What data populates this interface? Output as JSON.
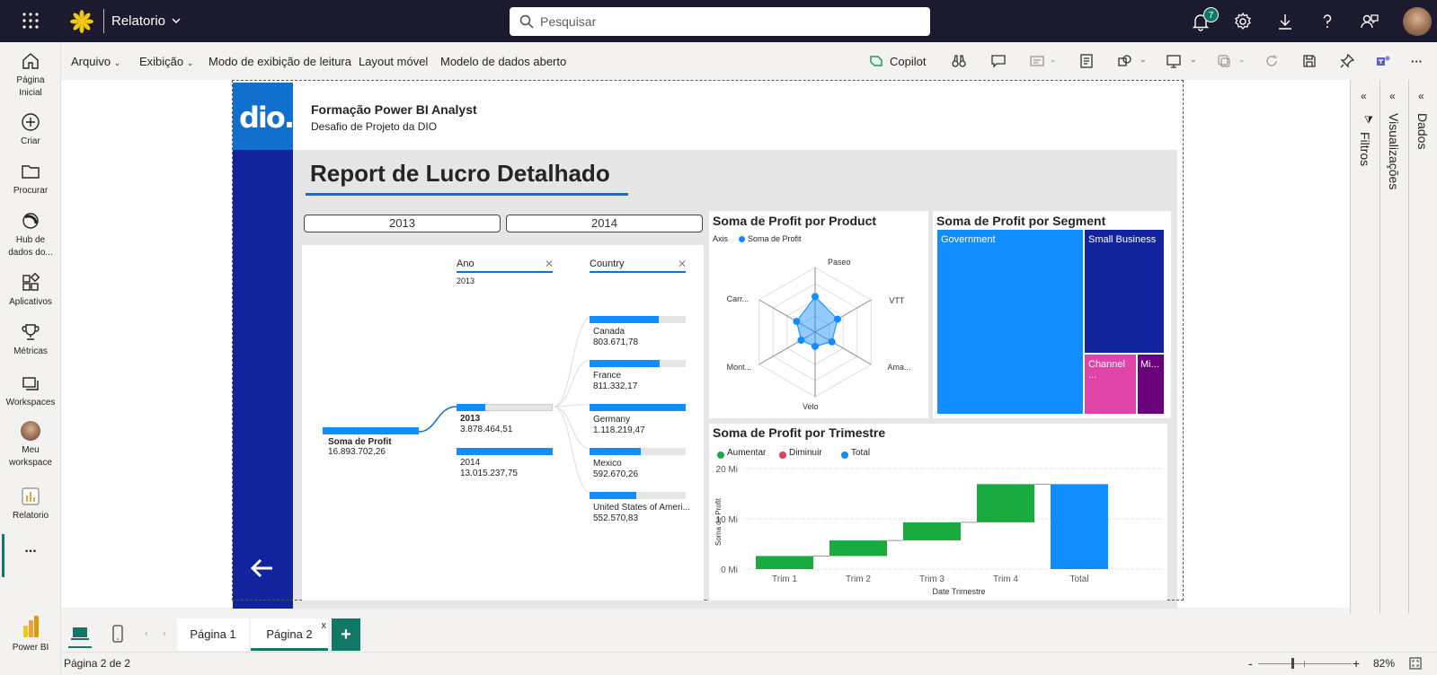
{
  "app": {
    "title": "Relatorio",
    "search_placeholder": "Pesquisar",
    "notification_count": "7",
    "brand_color": "#f2c811"
  },
  "nav": {
    "home": "Página Inicial",
    "create": "Criar",
    "browse": "Procurar",
    "datahub": "Hub de dados do...",
    "apps": "Aplicativos",
    "metrics": "Métricas",
    "workspaces": "Workspaces",
    "myworkspace": "Meu workspace",
    "report": "Relatorio",
    "more": "...",
    "powerbi": "Power BI"
  },
  "toolbar": {
    "file": "Arquivo",
    "view": "Exibição",
    "reading": "Modo de exibição de leitura",
    "mobile": "Layout móvel",
    "datamodel": "Modelo de dados aberto",
    "copilot": "Copilot"
  },
  "report": {
    "logo": "dio.",
    "header_title": "Formação Power BI Analyst",
    "header_subtitle": "Desafio de Projeto da DIO",
    "title": "Report de Lucro Detalhado",
    "year_buttons": [
      "2013",
      "2014"
    ]
  },
  "decomp": {
    "col1": "Ano",
    "col1_value": "2013",
    "col2": "Country",
    "root_label": "Soma de Profit",
    "root_value": "16.893.702,26",
    "years": [
      {
        "label": "2013",
        "value": "3.878.464,51",
        "pct": 0.3
      },
      {
        "label": "2014",
        "value": "13.015.237,75",
        "pct": 1.0
      }
    ],
    "countries": [
      {
        "label": "Canada",
        "value": "803.671,78",
        "pct": 0.72
      },
      {
        "label": "France",
        "value": "811.332,17",
        "pct": 0.73
      },
      {
        "label": "Germany",
        "value": "1.118.219,47",
        "pct": 1.0
      },
      {
        "label": "Mexico",
        "value": "592.670,26",
        "pct": 0.53
      },
      {
        "label": "United States of Ameri...",
        "value": "552.570,83",
        "pct": 0.49
      }
    ]
  },
  "radar": {
    "title": "Soma de Profit por Product",
    "legend_axis": "Axis",
    "legend_series": "Soma de Profit",
    "axes": [
      "Paseo",
      "VTT",
      "Ama...",
      "Velo",
      "Mont...",
      "Carr..."
    ]
  },
  "treemap": {
    "title": "Soma de Profit por Segment",
    "segments": [
      {
        "label": "Government",
        "color": "#118dff"
      },
      {
        "label": "Small Business",
        "color": "#12239e"
      },
      {
        "label": "Channel ...",
        "color": "#e044a7"
      },
      {
        "label": "Mi...",
        "color": "#6b007b"
      }
    ]
  },
  "chart_data": {
    "type": "bar",
    "title": "Soma de Profit por Trimestre",
    "xlabel": "Date Trimestre",
    "ylabel": "Soma de Profit",
    "legend": [
      "Aumentar",
      "Diminuir",
      "Total"
    ],
    "legend_colors": [
      "#1aab40",
      "#d64554",
      "#118dff"
    ],
    "categories": [
      "Trim 1",
      "Trim 2",
      "Trim 3",
      "Trim 4",
      "Total"
    ],
    "series": [
      {
        "name": "Aumentar",
        "values": [
          2.6,
          3.1,
          3.6,
          7.6,
          0
        ]
      },
      {
        "name": "Total",
        "values": [
          0,
          0,
          0,
          0,
          16.9
        ]
      }
    ],
    "ylim": [
      0,
      20
    ],
    "yticks": [
      "20 Mi",
      "10 Mi",
      "0 Mi"
    ]
  },
  "side": {
    "filters": "Filtros",
    "visualizations": "Visualizações",
    "data": "Dados"
  },
  "pages": {
    "page1": "Página 1",
    "page2": "Página 2",
    "close": "x",
    "add": "+"
  },
  "status": {
    "page_info": "Página 2 de 2",
    "zoom": "82%",
    "minus": "-",
    "plus": "+"
  }
}
